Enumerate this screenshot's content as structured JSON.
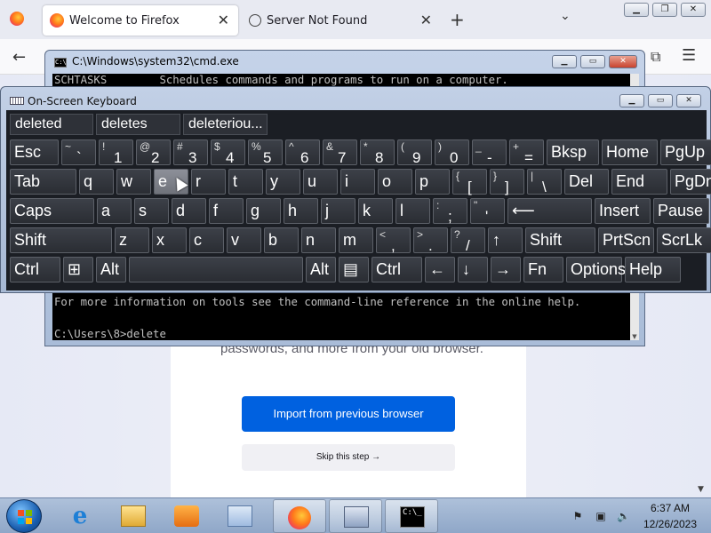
{
  "firefox": {
    "tabs": [
      {
        "label": "Welcome to Firefox"
      },
      {
        "label": "Server Not Found"
      }
    ],
    "close_glyph": "✕",
    "new_tab_glyph": "+",
    "tab_list_glyph": "⌄",
    "back_glyph": "←",
    "extensions_glyph": "⧉",
    "menu_glyph": "☰",
    "window_controls": {
      "minimize": "▁",
      "maximize": "❐",
      "close": "✕"
    },
    "page": {
      "welcome_text": "passwords, and more from your old browser.",
      "import_button": "Import from previous browser",
      "skip_button": "Skip this step →"
    }
  },
  "cmd": {
    "title": "C:\\Windows\\system32\\cmd.exe",
    "icon_text": "C:\\",
    "controls": {
      "minimize": "▁",
      "maximize": "▭",
      "close": "✕"
    },
    "lines": {
      "schtasks": "SCHTASKS        Schedules commands and programs to run on a computer.",
      "info": "For more information on tools see the command-line reference in the online help.",
      "prompt": "C:\\Users\\8>delete"
    },
    "scroll_down_glyph": "▼"
  },
  "osk": {
    "title": "On-Screen Keyboard",
    "controls": {
      "minimize": "▁",
      "maximize": "▭",
      "close": "✕"
    },
    "predictions": [
      "deleted",
      "deletes",
      "deleteriou..."
    ],
    "rows": [
      [
        {
          "id": "esc",
          "label": "Esc"
        },
        {
          "id": "tilde",
          "sec": "~",
          "pri": "`"
        },
        {
          "id": "1",
          "sec": "!",
          "pri": "1"
        },
        {
          "id": "2",
          "sec": "@",
          "pri": "2"
        },
        {
          "id": "3",
          "sec": "#",
          "pri": "3"
        },
        {
          "id": "4",
          "sec": "$",
          "pri": "4"
        },
        {
          "id": "5",
          "sec": "%",
          "pri": "5"
        },
        {
          "id": "6",
          "sec": "^",
          "pri": "6"
        },
        {
          "id": "7",
          "sec": "&",
          "pri": "7"
        },
        {
          "id": "8",
          "sec": "*",
          "pri": "8"
        },
        {
          "id": "9",
          "sec": "(",
          "pri": "9"
        },
        {
          "id": "0",
          "sec": ")",
          "pri": "0"
        },
        {
          "id": "minus",
          "sec": "_",
          "pri": "-"
        },
        {
          "id": "equals",
          "sec": "+",
          "pri": "="
        },
        {
          "id": "bksp",
          "label": "Bksp"
        },
        {
          "id": "home",
          "label": "Home"
        },
        {
          "id": "pgup",
          "label": "PgUp"
        }
      ],
      [
        {
          "id": "tab",
          "label": "Tab"
        },
        {
          "id": "q",
          "label": "q"
        },
        {
          "id": "w",
          "label": "w"
        },
        {
          "id": "e",
          "label": "e"
        },
        {
          "id": "r",
          "label": "r"
        },
        {
          "id": "t",
          "label": "t"
        },
        {
          "id": "y",
          "label": "y"
        },
        {
          "id": "u",
          "label": "u"
        },
        {
          "id": "i",
          "label": "i"
        },
        {
          "id": "o",
          "label": "o"
        },
        {
          "id": "p",
          "label": "p"
        },
        {
          "id": "lbracket",
          "sec": "{",
          "pri": "["
        },
        {
          "id": "rbracket",
          "sec": "}",
          "pri": "]"
        },
        {
          "id": "backslash",
          "sec": "|",
          "pri": "\\"
        },
        {
          "id": "del",
          "label": "Del"
        },
        {
          "id": "end",
          "label": "End"
        },
        {
          "id": "pgdn",
          "label": "PgDn"
        }
      ],
      [
        {
          "id": "caps",
          "label": "Caps"
        },
        {
          "id": "a",
          "label": "a"
        },
        {
          "id": "s",
          "label": "s"
        },
        {
          "id": "d",
          "label": "d"
        },
        {
          "id": "f",
          "label": "f"
        },
        {
          "id": "g",
          "label": "g"
        },
        {
          "id": "h",
          "label": "h"
        },
        {
          "id": "j",
          "label": "j"
        },
        {
          "id": "k",
          "label": "k"
        },
        {
          "id": "l",
          "label": "l"
        },
        {
          "id": "semicolon",
          "sec": ":",
          "pri": ";"
        },
        {
          "id": "quote",
          "sec": "\"",
          "pri": "'"
        },
        {
          "id": "enter",
          "label": "⟵"
        },
        {
          "id": "insert",
          "label": "Insert"
        },
        {
          "id": "pause",
          "label": "Pause"
        }
      ],
      [
        {
          "id": "lshift",
          "label": "Shift"
        },
        {
          "id": "z",
          "label": "z"
        },
        {
          "id": "x",
          "label": "x"
        },
        {
          "id": "c",
          "label": "c"
        },
        {
          "id": "v",
          "label": "v"
        },
        {
          "id": "b",
          "label": "b"
        },
        {
          "id": "n",
          "label": "n"
        },
        {
          "id": "m",
          "label": "m"
        },
        {
          "id": "comma",
          "sec": "<",
          "pri": ","
        },
        {
          "id": "period",
          "sec": ">",
          "pri": "."
        },
        {
          "id": "slash",
          "sec": "?",
          "pri": "/"
        },
        {
          "id": "up",
          "label": "↑"
        },
        {
          "id": "rshift",
          "label": "Shift"
        },
        {
          "id": "prtscn",
          "label": "PrtScn"
        },
        {
          "id": "scrlk",
          "label": "ScrLk"
        }
      ],
      [
        {
          "id": "lctrl",
          "label": "Ctrl"
        },
        {
          "id": "win",
          "label": "⊞"
        },
        {
          "id": "lalt",
          "label": "Alt"
        },
        {
          "id": "space",
          "label": ""
        },
        {
          "id": "ralt",
          "label": "Alt"
        },
        {
          "id": "menu",
          "label": "▤"
        },
        {
          "id": "rctrl",
          "label": "Ctrl"
        },
        {
          "id": "left",
          "label": "←"
        },
        {
          "id": "down",
          "label": "↓"
        },
        {
          "id": "right",
          "label": "→"
        },
        {
          "id": "fn",
          "label": "Fn"
        },
        {
          "id": "options",
          "label": "Options"
        },
        {
          "id": "help",
          "label": "Help"
        }
      ]
    ],
    "hovered_key": "e"
  },
  "taskbar": {
    "time": "6:37 AM",
    "date": "12/26/2023",
    "ie_glyph": "e",
    "cmd_icon_text": "C:\\_",
    "tray": {
      "flag": "⚑",
      "network": "▣",
      "volume": "🔈"
    }
  }
}
